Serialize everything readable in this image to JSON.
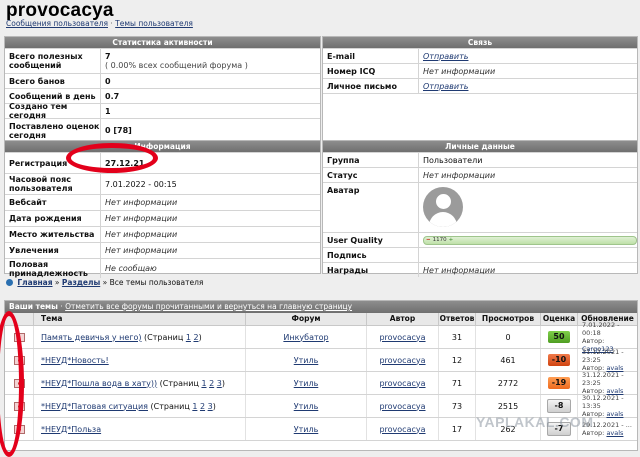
{
  "header": {
    "title": "provocacya",
    "breadcrumb": [
      "Сообщения пользователя",
      "Темы пользователя"
    ],
    "breadcrumb_sep": "·"
  },
  "stats": {
    "title": "Статистика активности",
    "rows": [
      {
        "key": "Всего полезных сообщений",
        "value": "7",
        "sub": "( 0.00% всех сообщений форума )"
      },
      {
        "key": "Всего банов",
        "value": "0"
      },
      {
        "key": "Сообщений в день",
        "value": "0.7"
      },
      {
        "key": "Создано тем сегодня",
        "value": "1"
      },
      {
        "key": "Поставлено оценок сегодня",
        "value": "0 [78]"
      }
    ]
  },
  "contact": {
    "title": "Связь",
    "rows": [
      {
        "key": "E-mail",
        "value": "Отправить",
        "link": true
      },
      {
        "key": "Номер ICQ",
        "value": "Нет информации"
      },
      {
        "key": "Личное письмо",
        "value": "Отправить",
        "link": true
      }
    ]
  },
  "info": {
    "title": "Информация",
    "rows": [
      {
        "key": "Регистрация",
        "value": "27.12.21"
      },
      {
        "key": "Часовой пояс пользователя",
        "value": "7.01.2022 - 00:15"
      },
      {
        "key": "Вебсайт",
        "value": "Нет информации"
      },
      {
        "key": "Дата рождения",
        "value": "Нет информации"
      },
      {
        "key": "Место жительства",
        "value": "Нет информации"
      },
      {
        "key": "Увлечения",
        "value": "Нет информации"
      },
      {
        "key": "Половая принадлежность",
        "value": "Не сообщаю"
      }
    ]
  },
  "personal": {
    "title": "Личные данные",
    "rows": [
      {
        "key": "Группа",
        "value": "Пользователи"
      },
      {
        "key": "Статус",
        "value": "Нет информации"
      },
      {
        "key": "Аватар",
        "value": ""
      },
      {
        "key": "User Quality",
        "value": "1170",
        "uq_minus": "−",
        "uq_plus": "+"
      },
      {
        "key": "Подпись",
        "value": ""
      },
      {
        "key": "Награды",
        "value": "Нет информации"
      }
    ]
  },
  "breadcrumb2": {
    "items": [
      "Главная",
      "Разделы",
      "Все темы пользователя"
    ],
    "sep": "»"
  },
  "topics": {
    "bar_title": "Ваши темы",
    "bar_sep": "·",
    "bar_link": "Отметить все форумы прочитанными и вернуться на главную страницу",
    "columns": [
      "Тема",
      "Форум",
      "Автор",
      "Ответов",
      "Просмотров",
      "Оценка",
      "Обновление"
    ],
    "pages_label": "Страниц",
    "author_prefix": "Автор:",
    "rows": [
      {
        "topic": "Память девичья у него)",
        "pages": [
          "1",
          "2"
        ],
        "forum": "Инкубатор",
        "author": "provocacya",
        "replies": "31",
        "views": "0",
        "score": "50",
        "score_color": "#5fb52e",
        "updated": "7.01.2022 - 00:18",
        "last_author": "Cargo123"
      },
      {
        "topic": "*НЕУД*Новость!",
        "pages": [],
        "forum": "Утиль",
        "author": "provocacya",
        "replies": "12",
        "views": "461",
        "score": "-10",
        "score_color": "#e0592a",
        "updated": "31.12.2021 - 23:25",
        "last_author": "avals"
      },
      {
        "topic": "*НЕУД*Пошла вода в хату))",
        "pages": [
          "1",
          "2",
          "3"
        ],
        "forum": "Утиль",
        "author": "provocacya",
        "replies": "71",
        "views": "2772",
        "score": "-19",
        "score_color": "#f07a2e",
        "updated": "31.12.2021 - 23:25",
        "last_author": "avals"
      },
      {
        "topic": "*НЕУД*Патовая ситуация",
        "pages": [
          "1",
          "2",
          "3"
        ],
        "forum": "Утиль",
        "author": "provocacya",
        "replies": "73",
        "views": "2515",
        "score": "-8",
        "score_color": "#dddddd",
        "updated": "30.12.2021 - 13:35",
        "last_author": "avals"
      },
      {
        "topic": "*НЕУД*Польза",
        "pages": [],
        "forum": "Утиль",
        "author": "provocacya",
        "replies": "17",
        "views": "262",
        "score": "-7",
        "score_color": "#dddddd",
        "updated": "29.12.2021 - ...",
        "last_author": "avals"
      }
    ]
  },
  "watermark": "YAPLAKAL.COM"
}
